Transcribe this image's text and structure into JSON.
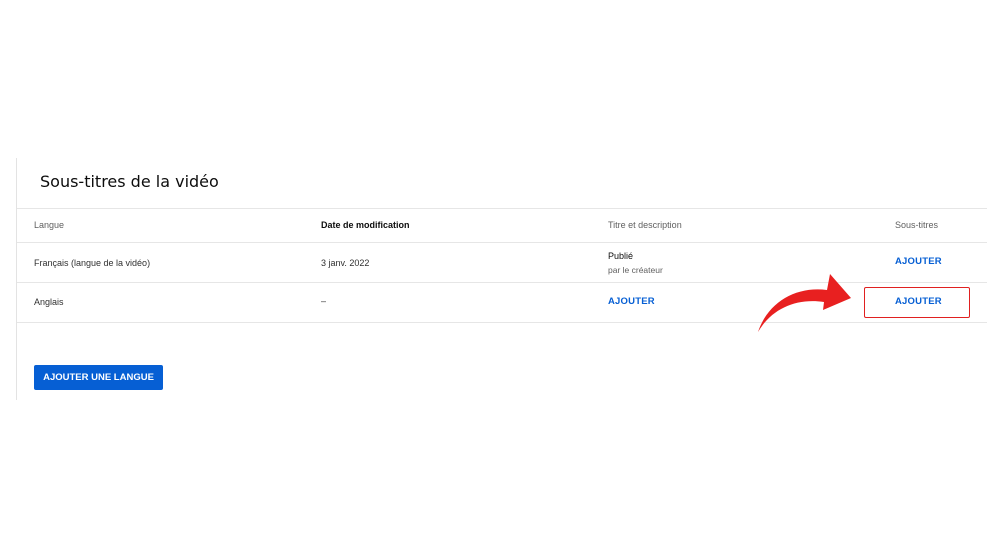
{
  "section": {
    "title": "Sous-titres de la vidéo"
  },
  "table": {
    "headers": [
      "Langue",
      "Date de modification",
      "Titre et description",
      "Sous-titres"
    ],
    "rows": [
      {
        "language": "Français (langue de la vidéo)",
        "date": "3 janv. 2022",
        "title_status": "Publié",
        "title_sub": "par le créateur",
        "subtitles": "AJOUTER"
      },
      {
        "language": "Anglais",
        "date": "–",
        "title_action": "AJOUTER",
        "subtitles": "AJOUTER"
      }
    ]
  },
  "add_language_button": "AJOUTER UNE LANGUE",
  "colors": {
    "accent": "#065fd4",
    "highlight": "#e02020",
    "arrow": "#e82020"
  },
  "annotation": {
    "arrow_icon": "red-curved-arrow-icon"
  }
}
